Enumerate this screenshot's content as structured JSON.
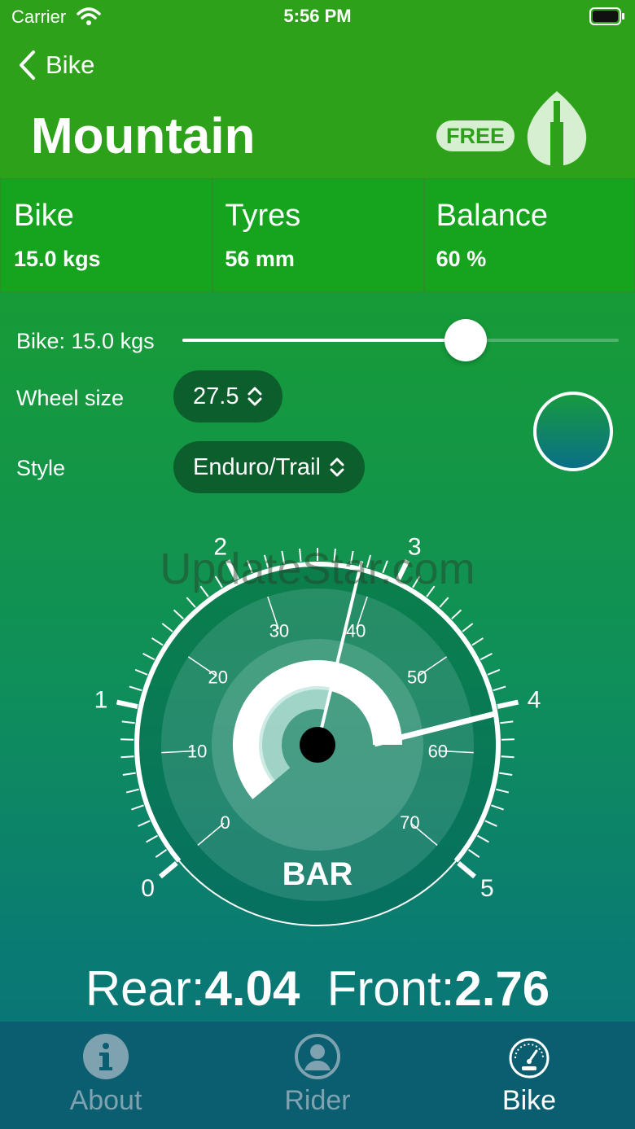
{
  "status": {
    "carrier": "Carrier",
    "time": "5:56 PM"
  },
  "header": {
    "back_label": "Bike",
    "title": "Mountain",
    "badge": "FREE"
  },
  "stats": [
    {
      "label": "Bike",
      "value": "15.0 kgs"
    },
    {
      "label": "Tyres",
      "value": "56 mm"
    },
    {
      "label": "Balance",
      "value": "60 %"
    }
  ],
  "controls": {
    "weight_label": "Bike: 15.0 kgs",
    "weight_slider_fraction": 0.65,
    "wheel_size_label": "Wheel size",
    "wheel_size_value": "27.5",
    "style_label": "Style",
    "style_value": "Enduro/Trail"
  },
  "gauge": {
    "unit_label": "BAR",
    "outer_ticks": [
      "0",
      "1",
      "2",
      "3",
      "4",
      "5"
    ],
    "inner_ticks": [
      "0",
      "10",
      "20",
      "30",
      "40",
      "50",
      "60",
      "70"
    ],
    "rear_needle_bar": 4.04,
    "front_needle_bar": 2.76,
    "watermark": "UpdateStar.com"
  },
  "readout": {
    "rear_label": "Rear:",
    "rear_value": "4.04",
    "front_label": "Front:",
    "front_value": "2.76"
  },
  "tabs": [
    {
      "label": "About",
      "icon": "info-icon",
      "active": false
    },
    {
      "label": "Rider",
      "icon": "person-icon",
      "active": false
    },
    {
      "label": "Bike",
      "icon": "speedometer-icon",
      "active": true
    }
  ],
  "colors": {
    "header_green": "#2ea11a",
    "stat_green": "#16a31d",
    "picker_bg": "#0c5e2c",
    "tab_bar": "#0a5e70"
  }
}
